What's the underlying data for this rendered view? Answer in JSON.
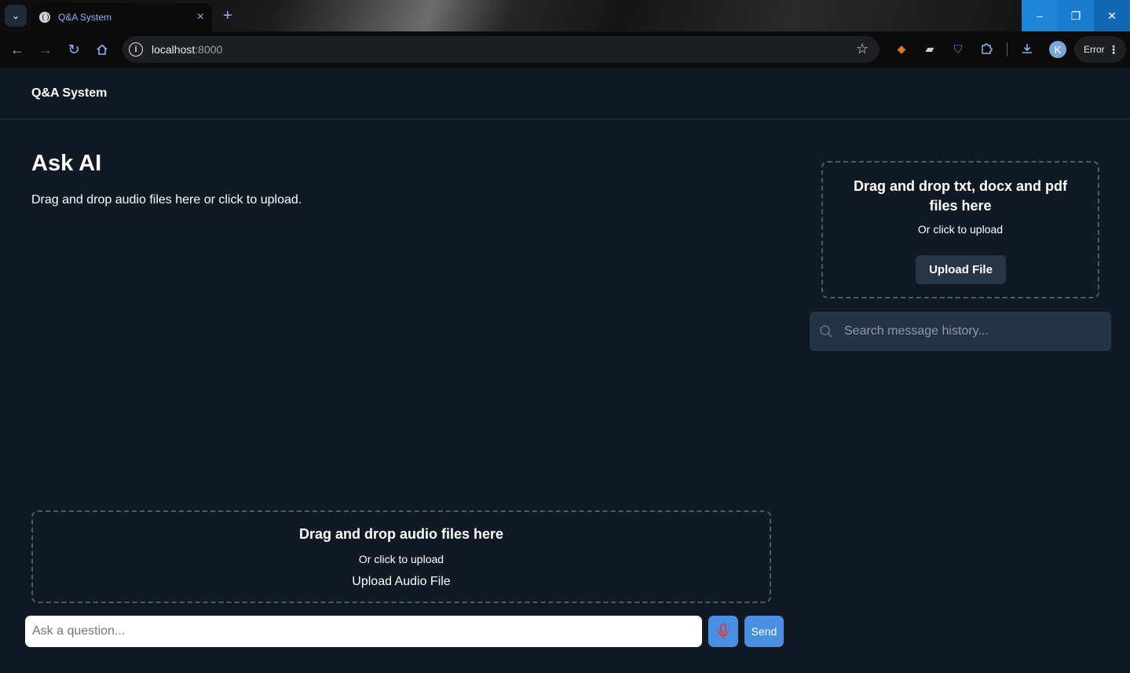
{
  "browser": {
    "tab_title": "Q&A System",
    "tab_close": "×",
    "new_tab": "+",
    "url_host": "localhost",
    "url_port": ":8000",
    "profile_initial": "K",
    "error_label": "Error",
    "window_buttons": {
      "minimize": "–",
      "restore": "❐",
      "close": "✕"
    },
    "accent": "#8ab4f8"
  },
  "app": {
    "title": "Q&A System"
  },
  "main": {
    "heading": "Ask AI",
    "subheading": "Drag and drop audio files here or click to upload."
  },
  "doc_upload": {
    "title": "Drag and drop txt, docx and pdf files here",
    "subtitle": "Or click to upload",
    "button_label": "Upload File"
  },
  "history_search": {
    "placeholder": "Search message history..."
  },
  "audio_upload": {
    "title": "Drag and drop audio files here",
    "subtitle": "Or click to upload",
    "link_label": "Upload Audio File"
  },
  "composer": {
    "placeholder": "Ask a question...",
    "send_label": "Send",
    "button_color": "#4a90e2",
    "mic_color": "#e53935"
  }
}
